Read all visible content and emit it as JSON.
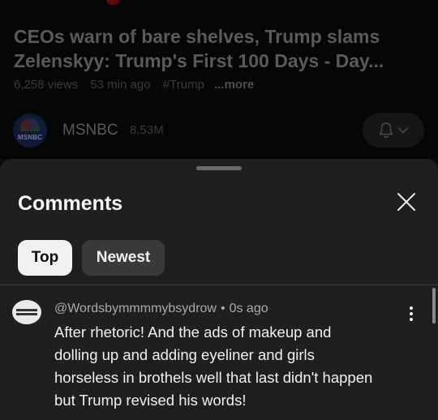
{
  "video": {
    "title_line1": "CEOs warn of bare shelves, Trump slams",
    "title_line2": "Zelenskyy: Trump's First 100 Days - Day...",
    "views": "6,258 views",
    "age": "53 min ago",
    "hashtag": "#Trump",
    "more_label": "...more"
  },
  "channel": {
    "logo_text": "MSNBC",
    "name": "MSNBC",
    "subscribers": "8.53M",
    "bell_icon": "bell-icon",
    "chevron_icon": "chevron-down-icon"
  },
  "comments_sheet": {
    "title": "Comments",
    "close_icon": "close-icon",
    "chips": {
      "top": "Top",
      "newest": "Newest",
      "selected": "Top"
    }
  },
  "comment": {
    "author": "@Wordsbymmmmybsydrow",
    "separator": "•",
    "time": "0s ago",
    "lines": [
      "After rhetoric! And the ads of makeup and",
      "dolling up and adding eyeliner and girls",
      "horseless in brothels well that last didn't happen",
      "but Trump revised his words!"
    ],
    "menu_icon": "more-vertical-icon"
  },
  "colors": {
    "sheet_background": "#1f1f1f",
    "selected_chip": "#f1f1f1",
    "unselected_chip": "#3a3a3a"
  }
}
